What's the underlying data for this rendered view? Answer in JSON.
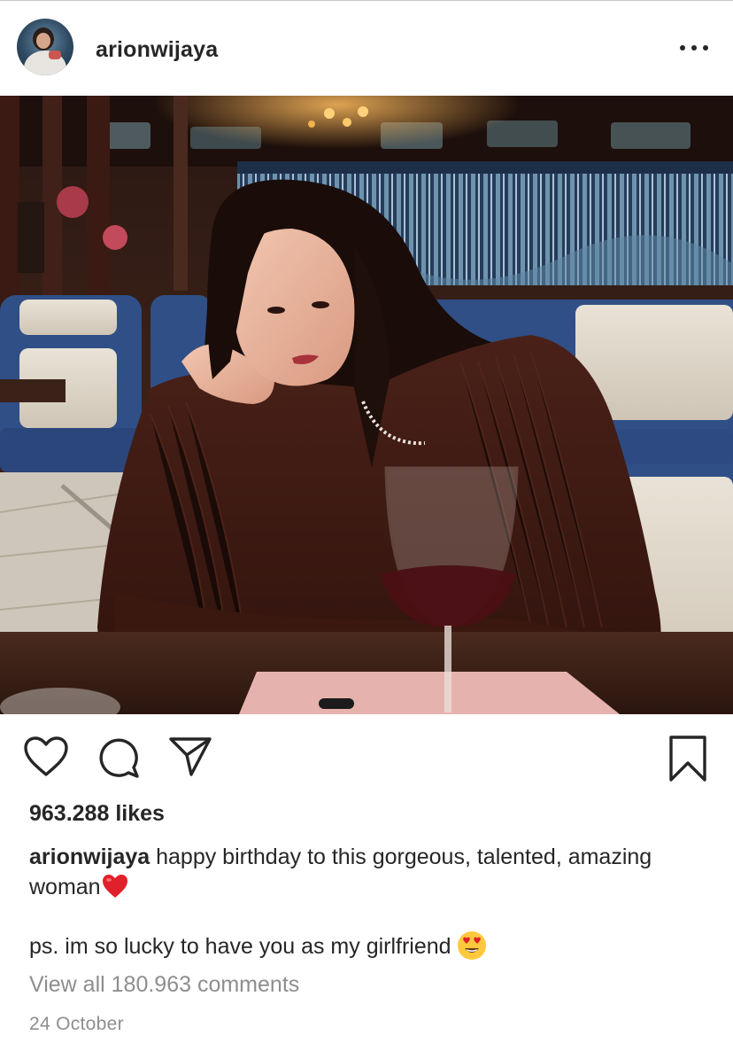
{
  "header": {
    "username": "arionwijaya",
    "more_icon": "more-horizontal-icon"
  },
  "photo": {
    "alt_subject": "photo"
  },
  "actions": {
    "like_icon": "heart-icon",
    "comment_icon": "comment-icon",
    "share_icon": "paper-plane-icon",
    "save_icon": "bookmark-icon"
  },
  "likes": "963.288 likes",
  "caption": {
    "username": "arionwijaya",
    "text": " happy birthday to this gorgeous, talented, amazing woman",
    "emoji": "red-heart-emoji",
    "ps_text": "ps. im so lucky to have you as my girlfriend",
    "ps_emoji": "heart-eyes-emoji"
  },
  "view_comments": "View all 180.963 comments",
  "date": "24 October",
  "colors": {
    "text": "#262626",
    "muted": "#8e8e8e",
    "heart": "#e0202a"
  }
}
